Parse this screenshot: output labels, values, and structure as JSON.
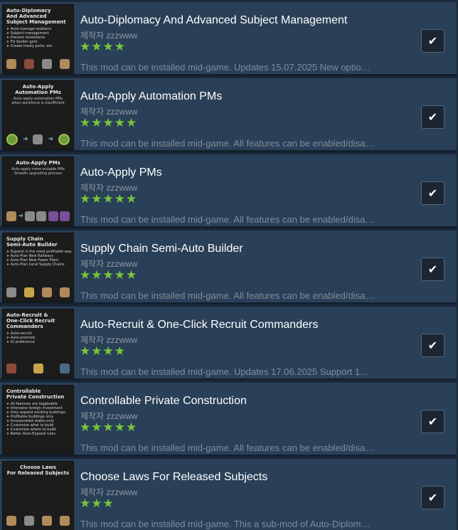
{
  "mods": [
    {
      "title": "Auto-Diplomacy And Advanced Subject Management",
      "author_prefix": "제작자",
      "author": "zzzwww",
      "rating": 4,
      "description": "This mod can be installed mid-game. Updates 15.07.2025 New optio…",
      "checked": true,
      "thumb": {
        "title": "Auto-Diplomacy\nAnd Advanced\nSubject Management",
        "subtitle": "",
        "bullets": [
          "Auto-manage relations",
          "Subject management",
          "Prevent revolutions",
          "Fix border gore",
          "Create treaty ports, etc."
        ],
        "icons": [
          "building-icon",
          "house-icon",
          "anchor-icon",
          "factory-icon"
        ]
      }
    },
    {
      "title": "Auto-Apply Automation PMs",
      "author_prefix": "제작자",
      "author": "zzzwww",
      "rating": 5,
      "description": "This mod can be installed mid-game. All features can be enabled/disa…",
      "checked": true,
      "thumb": {
        "title": "Auto-Apply\nAutomation PMs",
        "subtitle": "Auto-apply automation PMs\nwhen workforce is insufficient",
        "bullets": [],
        "icons": [
          "gear-icon",
          "branch-icon",
          "workers-icon"
        ]
      }
    },
    {
      "title": "Auto-Apply PMs",
      "author_prefix": "제작자",
      "author": "zzzwww",
      "rating": 5,
      "description": "This mod can be installed mid-game. All features can be enabled/disa…",
      "checked": true,
      "thumb": {
        "title": "Auto-Apply PMs",
        "subtitle": "Auto-apply more suitable PMs\nSmooth upgrading process",
        "bullets": [],
        "icons": [
          "tools-icon",
          "branch-icon",
          "derrick-icon",
          "silk-icon",
          "fabric-icon"
        ]
      }
    },
    {
      "title": "Supply Chain Semi-Auto Builder",
      "author_prefix": "제작자",
      "author": "zzzwww",
      "rating": 5,
      "description": "This mod can be installed mid-game. All features can be enabled/disa…",
      "checked": true,
      "thumb": {
        "title": "Supply Chain\nSemi-Auto Builder",
        "subtitle": "",
        "bullets": [
          "Expand in the most profitable way",
          "Auto-Plan New Railways",
          "Auto-Plan New Power Plant",
          "Auto-Plan Local Supply Chains"
        ],
        "icons": [
          "cotton-icon",
          "grain-icon",
          "barrel-icon",
          "tools-icon"
        ]
      }
    },
    {
      "title": "Auto-Recruit & One-Click Recruit Commanders",
      "author_prefix": "제작자",
      "author": "zzzwww",
      "rating": 4,
      "description": "This mod can be installed mid-game. Updates 17.06.2025 Support 1…",
      "checked": true,
      "thumb": {
        "title": "Auto-Recruit &\nOne-Click Recruit\nCommanders",
        "subtitle": "",
        "bullets": [
          "Auto-recruit",
          "Auto-promote",
          "IG preference"
        ],
        "icons": [
          "swords-icon",
          "medal-icon",
          "globe-icon"
        ]
      }
    },
    {
      "title": "Controllable Private Construction",
      "author_prefix": "제작자",
      "author": "zzzwww",
      "rating": 5,
      "description": "This mod can be installed mid-game. All features can be enabled/disa…",
      "checked": true,
      "thumb": {
        "title": "Controllable\nPrivate Construction",
        "subtitle": "",
        "bullets": [
          "All features are toggleable",
          "Intervene foreign investment",
          "Only expand existing buildings",
          "Profitable buildings only",
          "Incorporated states only",
          "Customize what to build",
          "Customize where to build",
          "Better Auto-Expand rules"
        ],
        "icons": []
      }
    },
    {
      "title": "Choose Laws For Released Subjects",
      "author_prefix": "제작자",
      "author": "zzzwww",
      "rating": 3,
      "description": "This mod can be installed mid-game. This a sub-mod of Auto-Diplom…",
      "checked": true,
      "thumb": {
        "title": "Choose Laws\nFor Released Subjects",
        "subtitle": "",
        "bullets": [],
        "icons": [
          "flag-icon",
          "people-icon",
          "factory-icon",
          "crowd-icon"
        ]
      }
    }
  ],
  "colors": {
    "star": "#77c53a",
    "row_bg": "#2a4058",
    "title": "#ffffff",
    "author": "#8f98a0",
    "description": "#7d8d9c"
  }
}
